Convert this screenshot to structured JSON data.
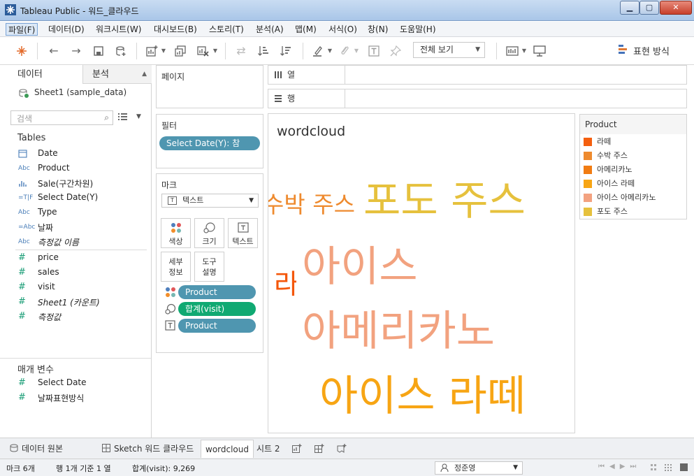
{
  "window": {
    "title": "Tableau Public - 워드_클라우드"
  },
  "menu": [
    "파일(F)",
    "데이터(D)",
    "워크시트(W)",
    "대시보드(B)",
    "스토리(T)",
    "분석(A)",
    "맵(M)",
    "서식(O)",
    "창(N)",
    "도움말(H)"
  ],
  "toolbar": {
    "view_select": "전체 보기",
    "show_me": "표현 방식"
  },
  "data_pane": {
    "tab_data": "데이터",
    "tab_analysis": "분석",
    "datasource": "Sheet1 (sample_data)",
    "search_placeholder": "검색",
    "tables_header": "Tables",
    "dimensions": [
      {
        "icon": "calendar-icon",
        "label": "Date"
      },
      {
        "icon": "Abc",
        "label": "Product"
      },
      {
        "icon": "bin-icon",
        "label": "Sale(구간차원)"
      },
      {
        "icon": "=T|F",
        "label": "Select Date(Y)"
      },
      {
        "icon": "Abc",
        "label": "Type"
      },
      {
        "icon": "=Abc",
        "label": "날짜"
      },
      {
        "icon": "Abc",
        "label": "측정값 이름"
      }
    ],
    "measures": [
      {
        "label": "price"
      },
      {
        "label": "sales"
      },
      {
        "label": "visit"
      },
      {
        "label": "Sheet1 (카운트)"
      },
      {
        "label": "측정값"
      }
    ],
    "params_header": "매개 변수",
    "params": [
      {
        "label": "Select Date"
      },
      {
        "label": "날짜표현방식"
      }
    ]
  },
  "cards": {
    "pages": "페이지",
    "filters": "필터",
    "filter_pill": "Select Date(Y): 참",
    "marks": "마크",
    "mark_type": "텍스트",
    "buttons": [
      "색상",
      "크기",
      "텍스트",
      "세부\n정보",
      "도구\n설명"
    ],
    "btn_color": "색상",
    "btn_size": "크기",
    "btn_text": "텍스트",
    "btn_detail_1": "세부",
    "btn_detail_2": "정보",
    "btn_tooltip_1": "도구",
    "btn_tooltip_2": "설명",
    "enc_color": "Product",
    "enc_size": "합계(visit)",
    "enc_text": "Product"
  },
  "shelves": {
    "columns": "열",
    "rows": "행"
  },
  "viz": {
    "title": "wordcloud",
    "words": [
      {
        "text": "수박 주스",
        "color": "#ee8a2e"
      },
      {
        "text": "포도 주스",
        "color": "#e6c13d"
      },
      {
        "text": "라떼",
        "color": "#f4570a"
      },
      {
        "text": "아이스",
        "color": "#f2a27f"
      },
      {
        "text": "아메리카노",
        "color": "#f2a27f"
      },
      {
        "text": "아이스 라떼",
        "color": "#f7a514"
      }
    ]
  },
  "legend": {
    "title": "Product",
    "items": [
      {
        "label": "라떼",
        "color": "#f45f0f"
      },
      {
        "label": "수박 주스",
        "color": "#ee8a2e"
      },
      {
        "label": "아메리카노",
        "color": "#f17c12"
      },
      {
        "label": "아이스 라떼",
        "color": "#f7a514"
      },
      {
        "label": "아이스 아메리카노",
        "color": "#f3a280"
      },
      {
        "label": "포도 주스",
        "color": "#e6c13d"
      }
    ]
  },
  "sheets": {
    "datasource_tab": "데이터 원본",
    "sketch_tab": "Sketch 워드 클라우드",
    "active_tab": "wordcloud",
    "sheet2_tab": "시트 2"
  },
  "status": {
    "marks": "마크 6개",
    "rows": "행 1개 기준 1 열",
    "sum": "합계(visit): 9,269",
    "user": "정준영"
  }
}
